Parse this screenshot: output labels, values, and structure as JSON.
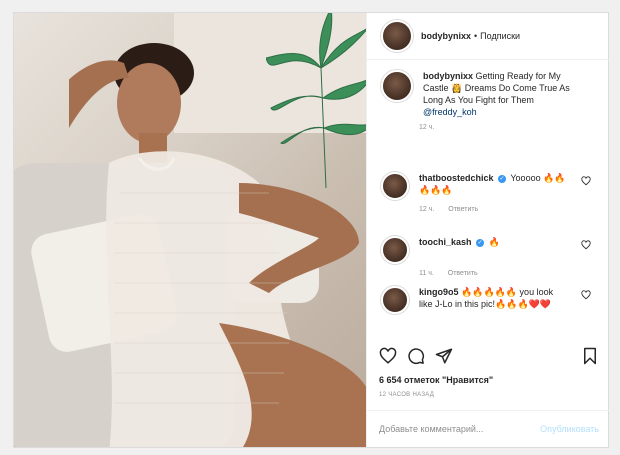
{
  "post": {
    "username": "bodybynixx",
    "separator": "•",
    "follow_label": "Подписки",
    "caption_user": "bodybynixx",
    "caption_text": "Getting Ready for My Castle 👸 Dreams Do Come True As Long As You Fight for Them",
    "caption_mention": "@freddy_koh",
    "caption_time": "12 ч.",
    "likes": "6 654 отметок \"Нравится\"",
    "posted_ago": "12 ЧАСОВ НАЗАД",
    "add_comment_placeholder": "Добавьте комментарий...",
    "publish_label": "Опубликовать"
  },
  "comments": [
    {
      "user": "thatboostedchick",
      "verified": "✓",
      "text": "Yooooo 🔥🔥🔥🔥🔥",
      "time": "12 ч.",
      "reply": "Ответить"
    },
    {
      "user": "toochi_kash",
      "verified": "✓",
      "text": "🔥",
      "time": "11 ч.",
      "reply": "Ответить"
    },
    {
      "user": "kingo9o5",
      "text": "🔥🔥🔥🔥🔥 you look like J-Lo in this pic!🔥🔥🔥❤️❤️"
    }
  ],
  "icons": [
    "heart-icon",
    "comment-icon",
    "share-icon",
    "bookmark-icon"
  ],
  "colors": {
    "link": "#00376b",
    "verified": "#3897f0",
    "muted": "#8e8e8e",
    "publish": "#b2dffc"
  }
}
